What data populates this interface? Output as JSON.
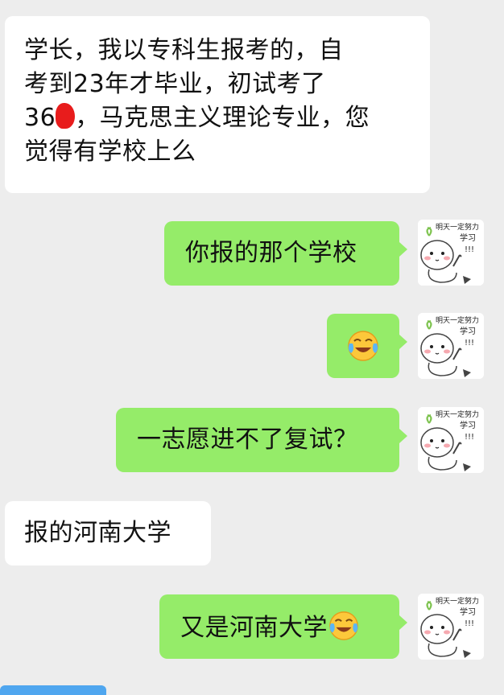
{
  "messages": [
    {
      "sender": "other",
      "lines": [
        "学长，我以专科生报考的，自",
        "考到23年才毕业，初试考了",
        "36",
        "，马克思主义理论专业，您",
        "觉得有学校上么"
      ]
    },
    {
      "sender": "me",
      "text": "你报的那个学校",
      "avatar": "sticker-avatar"
    },
    {
      "sender": "me",
      "text": "",
      "emoji": "crying-laughing-emoji",
      "avatar": "sticker-avatar"
    },
    {
      "sender": "me",
      "text": "一志愿进不了复试？",
      "avatar": "sticker-avatar"
    },
    {
      "sender": "other",
      "text": "报的河南大学"
    },
    {
      "sender": "me",
      "text": "又是河南大学",
      "emoji": "crying-laughing-emoji",
      "avatar": "sticker-avatar"
    }
  ],
  "avatar_caption": [
    "明天一定努力",
    "学习",
    "!!!"
  ],
  "colors": {
    "background": "#ededed",
    "incoming": "#ffffff",
    "outgoing": "#95ec69"
  }
}
